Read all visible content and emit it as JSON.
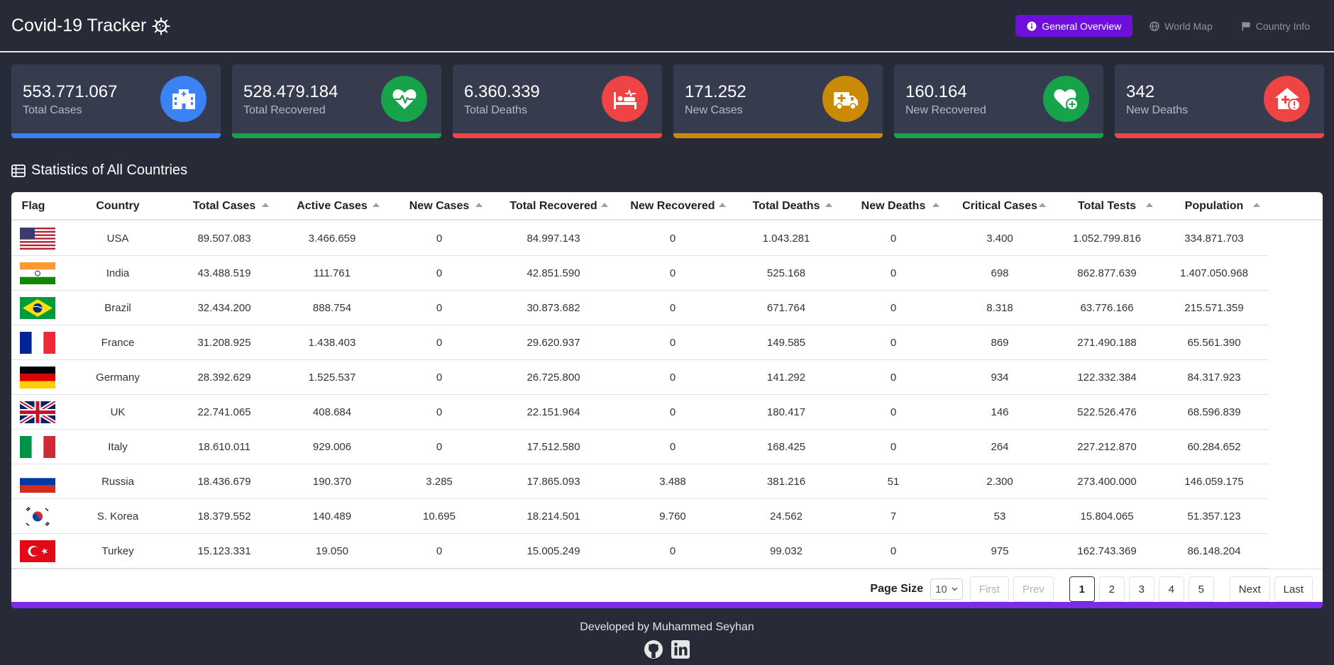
{
  "app": {
    "title": "Covid-19 Tracker",
    "nav": [
      {
        "label": "General Overview",
        "icon": "info-icon",
        "active": true
      },
      {
        "label": "World Map",
        "icon": "globe-icon",
        "active": false
      },
      {
        "label": "Country Info",
        "icon": "flag-icon",
        "active": false
      }
    ]
  },
  "stats": [
    {
      "value": "553.771.067",
      "label": "Total Cases",
      "icon": "hospital-icon",
      "color": "#3b82f6"
    },
    {
      "value": "528.479.184",
      "label": "Total Recovered",
      "icon": "heartbeat-icon",
      "color": "#16a34a"
    },
    {
      "value": "6.360.339",
      "label": "Total Deaths",
      "icon": "hospital-bed-icon",
      "color": "#ef4444"
    },
    {
      "value": "171.252",
      "label": "New Cases",
      "icon": "ambulance-icon",
      "color": "#ca8a04"
    },
    {
      "value": "160.164",
      "label": "New Recovered",
      "icon": "heart-plus-icon",
      "color": "#16a34a"
    },
    {
      "value": "342",
      "label": "New Deaths",
      "icon": "house-medical-alert-icon",
      "color": "#ef4444"
    }
  ],
  "section_title": "Statistics of All Countries",
  "table": {
    "columns": [
      "Flag",
      "Country",
      "Total Cases",
      "Active Cases",
      "New Cases",
      "Total Recovered",
      "New Recovered",
      "Total Deaths",
      "New Deaths",
      "Critical Cases",
      "Total Tests",
      "Population"
    ],
    "rows": [
      {
        "flag": "usa",
        "cells": [
          "USA",
          "89.507.083",
          "3.466.659",
          "0",
          "84.997.143",
          "0",
          "1.043.281",
          "0",
          "3.400",
          "1.052.799.816",
          "334.871.703"
        ]
      },
      {
        "flag": "india",
        "cells": [
          "India",
          "43.488.519",
          "111.761",
          "0",
          "42.851.590",
          "0",
          "525.168",
          "0",
          "698",
          "862.877.639",
          "1.407.050.968"
        ]
      },
      {
        "flag": "brazil",
        "cells": [
          "Brazil",
          "32.434.200",
          "888.754",
          "0",
          "30.873.682",
          "0",
          "671.764",
          "0",
          "8.318",
          "63.776.166",
          "215.571.359"
        ]
      },
      {
        "flag": "france",
        "cells": [
          "France",
          "31.208.925",
          "1.438.403",
          "0",
          "29.620.937",
          "0",
          "149.585",
          "0",
          "869",
          "271.490.188",
          "65.561.390"
        ]
      },
      {
        "flag": "germany",
        "cells": [
          "Germany",
          "28.392.629",
          "1.525.537",
          "0",
          "26.725.800",
          "0",
          "141.292",
          "0",
          "934",
          "122.332.384",
          "84.317.923"
        ]
      },
      {
        "flag": "uk",
        "cells": [
          "UK",
          "22.741.065",
          "408.684",
          "0",
          "22.151.964",
          "0",
          "180.417",
          "0",
          "146",
          "522.526.476",
          "68.596.839"
        ]
      },
      {
        "flag": "italy",
        "cells": [
          "Italy",
          "18.610.011",
          "929.006",
          "0",
          "17.512.580",
          "0",
          "168.425",
          "0",
          "264",
          "227.212.870",
          "60.284.652"
        ]
      },
      {
        "flag": "russia",
        "cells": [
          "Russia",
          "18.436.679",
          "190.370",
          "3.285",
          "17.865.093",
          "3.488",
          "381.216",
          "51",
          "2.300",
          "273.400.000",
          "146.059.175"
        ]
      },
      {
        "flag": "south-korea",
        "cells": [
          "S. Korea",
          "18.379.552",
          "140.489",
          "10.695",
          "18.214.501",
          "9.760",
          "24.562",
          "7",
          "53",
          "15.804.065",
          "51.357.123"
        ]
      },
      {
        "flag": "turkey",
        "cells": [
          "Turkey",
          "15.123.331",
          "19.050",
          "0",
          "15.005.249",
          "0",
          "99.032",
          "0",
          "975",
          "162.743.369",
          "86.148.204"
        ]
      }
    ]
  },
  "pagination": {
    "page_size_label": "Page Size",
    "page_size": "10",
    "first": "First",
    "prev": "Prev",
    "pages": [
      "1",
      "2",
      "3",
      "4",
      "5"
    ],
    "current": "1",
    "next": "Next",
    "last": "Last"
  },
  "footer": {
    "text": "Developed by Muhammed Seyhan",
    "links": [
      "github-icon",
      "linkedin-icon"
    ]
  }
}
